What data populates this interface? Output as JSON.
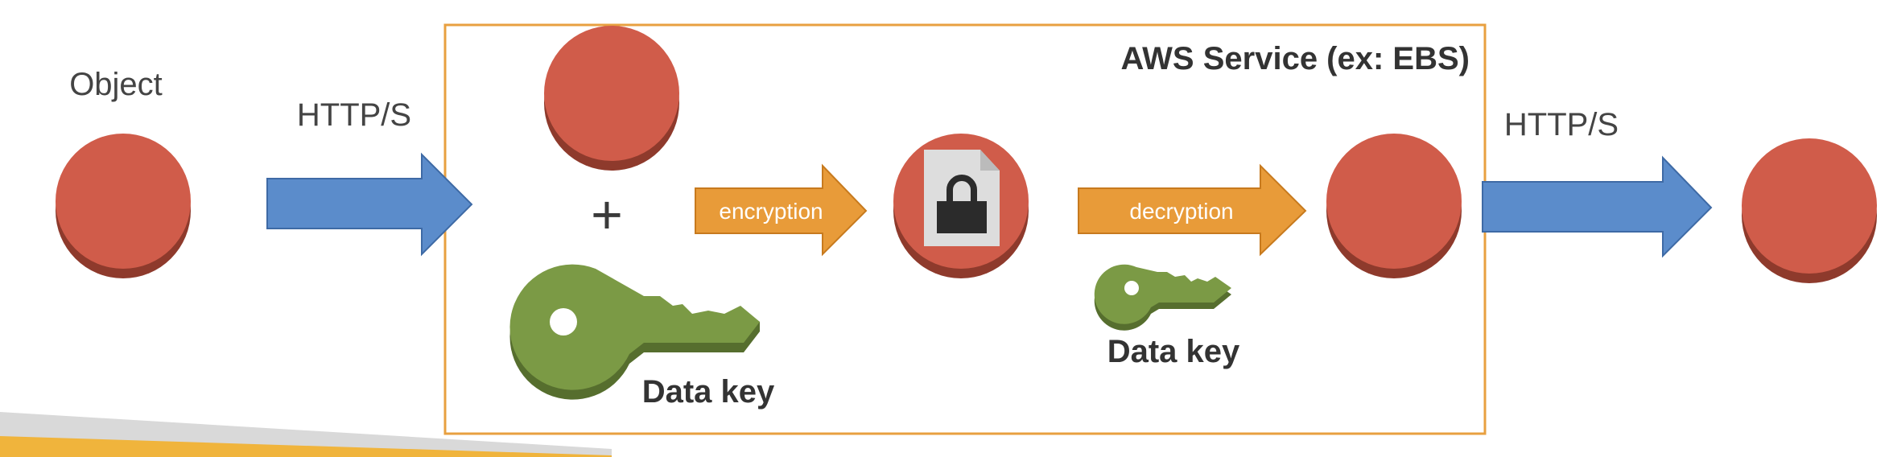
{
  "labels": {
    "object": "Object",
    "protocol_in": "HTTP/S",
    "protocol_out": "HTTP/S",
    "service_title": "AWS Service (ex: EBS)",
    "plus": "+",
    "encryption": "encryption",
    "decryption": "decryption",
    "data_key_1": "Data key",
    "data_key_2": "Data key"
  },
  "colors": {
    "object_red": "#D05C4A",
    "object_shadow": "#8E3A2C",
    "transfer_blue": "#5B8CCB",
    "process_orange": "#E89B39",
    "key_green": "#7B9A45",
    "key_shadow": "#566E2E",
    "service_border": "#E8A040"
  },
  "icons": {
    "object": "red-disc-object",
    "encrypted_object": "locked-file-icon",
    "key": "key-icon"
  }
}
